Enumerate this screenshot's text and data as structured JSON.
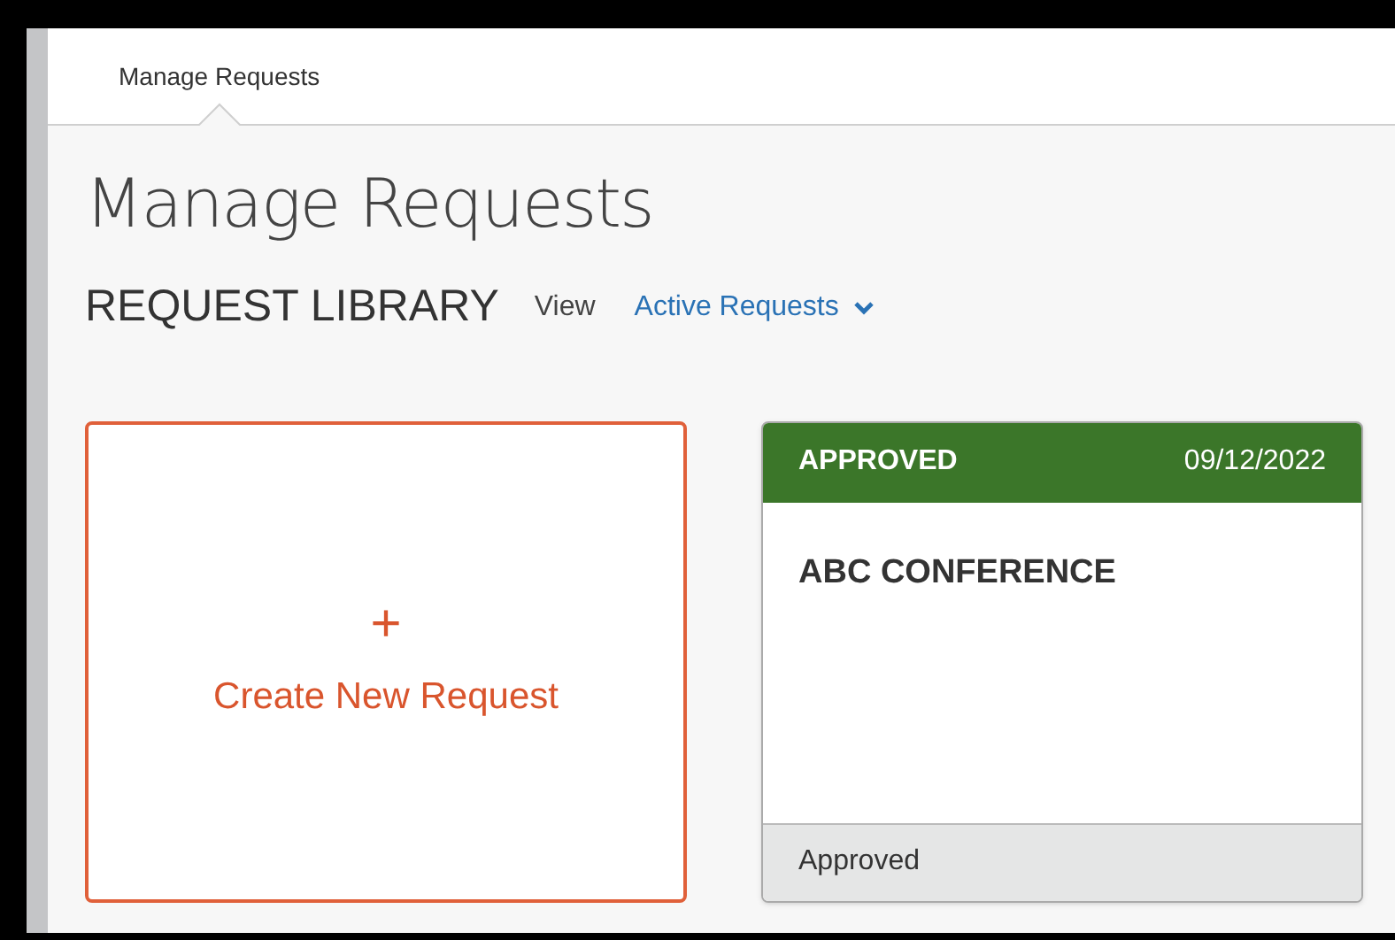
{
  "tabs": [
    {
      "label": "Manage Requests",
      "selected": true
    }
  ],
  "page_title": "Manage Requests",
  "library": {
    "heading": "REQUEST LIBRARY",
    "view_label": "View",
    "filter": "Active Requests"
  },
  "create_card": {
    "icon": "+",
    "label": "Create New Request"
  },
  "requests": [
    {
      "status": "APPROVED",
      "date": "09/12/2022",
      "color": "#3b7629",
      "name": "ABC CONFERENCE",
      "footer": "Approved"
    }
  ]
}
